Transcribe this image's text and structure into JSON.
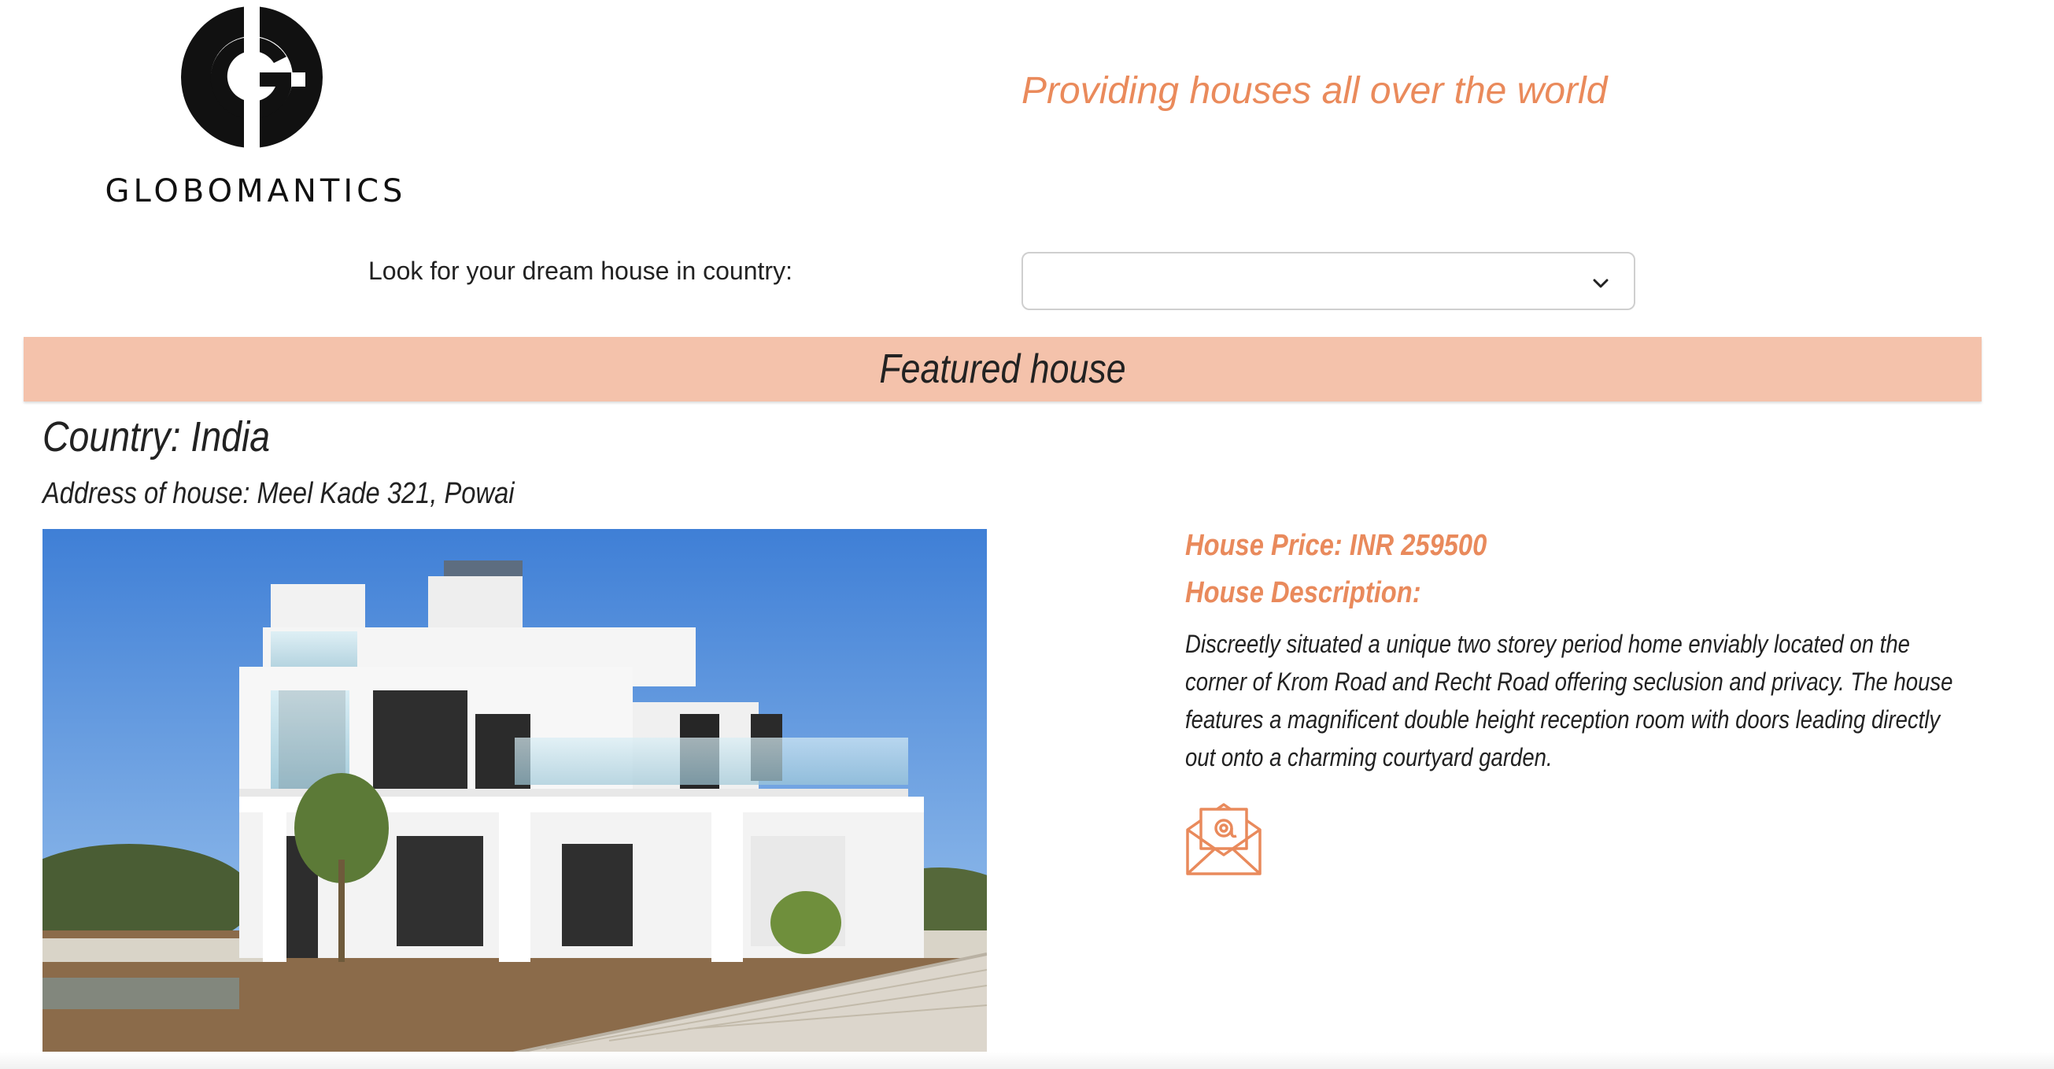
{
  "brand": {
    "name": "GLOBOMANTICS",
    "logo_icon": "globomantics-g-logo"
  },
  "header": {
    "tagline": "Providing houses all over the world"
  },
  "search": {
    "label": "Look for your dream house in country:",
    "selected_value": "",
    "dropdown_icon": "chevron-down-icon"
  },
  "featured": {
    "title": "Featured house",
    "country": "Country: India",
    "address": "Address of house: Meel Kade 321, Powai",
    "price": "House Price: INR 259500",
    "description_label": "House Description:",
    "description": "Discreetly situated a unique two storey period home enviably located on the corner of Krom Road and Recht Road offering seclusion and privacy. The house features a magnificent double height reception room with doors leading directly out onto a charming courtyard garden.",
    "photo_icon": "house-photo",
    "contact_icon": "email-icon"
  },
  "colors": {
    "accent": "#ea8a5b",
    "banner": "#f4c2ab",
    "text": "#222222"
  }
}
